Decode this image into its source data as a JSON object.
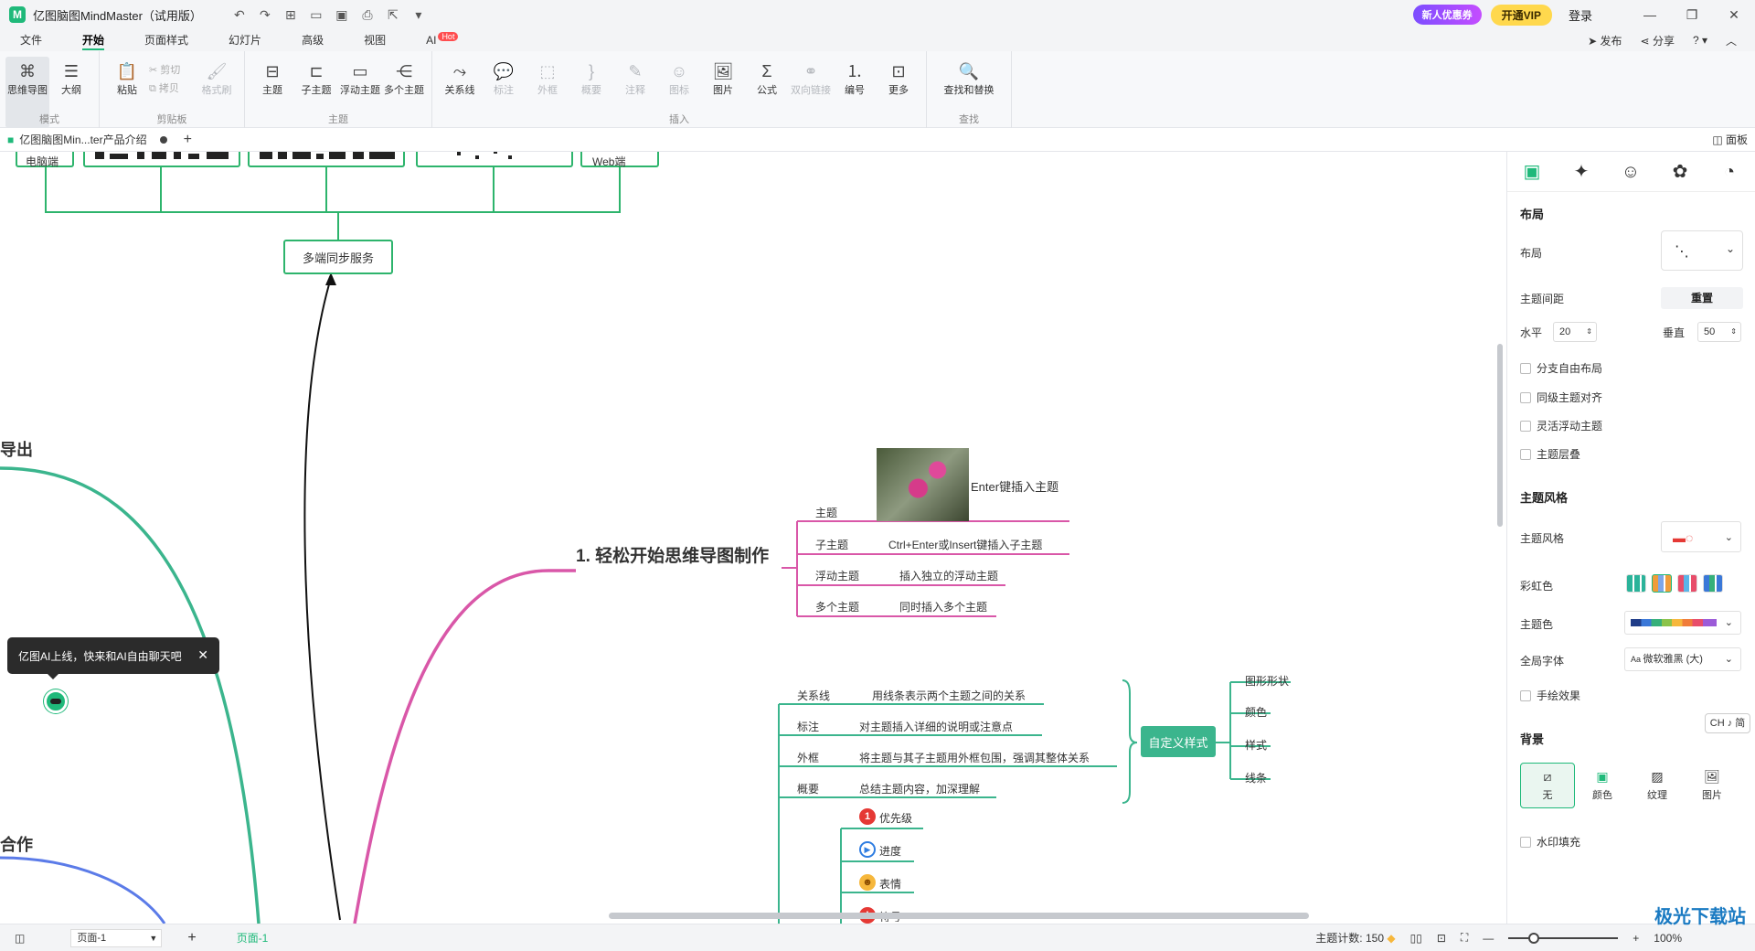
{
  "titlebar": {
    "app_title": "亿图脑图MindMaster（试用版）",
    "promo": "新人优惠券",
    "vip": "开通VIP",
    "login": "登录"
  },
  "menu": {
    "items": [
      "文件",
      "开始",
      "页面样式",
      "幻灯片",
      "高级",
      "视图",
      "AI"
    ],
    "hot": "Hot",
    "publish": "发布",
    "share": "分享"
  },
  "ribbon": {
    "mode": {
      "label": "模式",
      "mindmap": "思维导图",
      "outline": "大纲"
    },
    "clipboard": {
      "label": "剪贴板",
      "paste": "粘贴",
      "cut": "剪切",
      "copy": "拷贝",
      "format_painter": "格式刷"
    },
    "topic": {
      "label": "主题",
      "topic": "主题",
      "subtopic": "子主题",
      "floating": "浮动主题",
      "multi": "多个主题"
    },
    "insert": {
      "label": "插入",
      "relation": "关系线",
      "callout": "标注",
      "boundary": "外框",
      "summary": "概要",
      "note": "注释",
      "icon": "图标",
      "image": "图片",
      "formula": "公式",
      "hyperlink": "双向链接",
      "numbering": "编号",
      "more": "更多"
    },
    "find": {
      "label": "查找",
      "find_replace": "查找和替换"
    }
  },
  "tabs": {
    "doc_name": "亿图脑图Min...ter产品介绍",
    "panel_toggle": "面板"
  },
  "canvas": {
    "top_labels": {
      "pc": "电脑端",
      "web": "Web端"
    },
    "sync_service": "多端同步服务",
    "left_partial_1": "导出",
    "left_partial_2": "合作",
    "main_topic": "1. 轻松开始思维导图制作",
    "image_caption": "Enter键插入主题",
    "rows": [
      {
        "label": "主题",
        "desc": ""
      },
      {
        "label": "子主题",
        "desc": "Ctrl+Enter或Insert键插入子主题"
      },
      {
        "label": "浮动主题",
        "desc": "插入独立的浮动主题"
      },
      {
        "label": "多个主题",
        "desc": "同时插入多个主题"
      }
    ],
    "rows2": [
      {
        "label": "关系线",
        "desc": "用线条表示两个主题之间的关系"
      },
      {
        "label": "标注",
        "desc": "对主题插入详细的说明或注意点"
      },
      {
        "label": "外框",
        "desc": "将主题与其子主题用外框包围，强调其整体关系"
      },
      {
        "label": "概要",
        "desc": "总结主题内容，加深理解"
      }
    ],
    "custom_style": "自定义样式",
    "custom_items": [
      "图形形状",
      "颜色",
      "样式",
      "线条"
    ],
    "markers": [
      "优先级",
      "进度",
      "表情",
      "符号"
    ],
    "ai_toast": "亿图AI上线，快来和AI自由聊天吧"
  },
  "panel": {
    "layout_section": "布局",
    "layout_label": "布局",
    "spacing_label": "主题间距",
    "reset": "重置",
    "horizontal_label": "水平",
    "horizontal_value": "20",
    "vertical_label": "垂直",
    "vertical_value": "50",
    "checks1": [
      "分支自由布局",
      "同级主题对齐",
      "灵活浮动主题",
      "主题层叠"
    ],
    "style_section": "主题风格",
    "style_label": "主题风格",
    "rainbow_label": "彩虹色",
    "theme_color_label": "主题色",
    "font_label": "全局字体",
    "font_value": "微软雅黑 (大)",
    "hand_drawn": "手绘效果",
    "bg_section": "背景",
    "bg_options": [
      "无",
      "颜色",
      "纹理",
      "图片"
    ],
    "watermark_fill": "水印填充",
    "ime": "CH ♪ 简"
  },
  "status": {
    "page_select": "页面-1",
    "page_tab": "页面-1",
    "topic_count_label": "主题计数:",
    "topic_count": "150",
    "zoom": "100%"
  },
  "watermark": "极光下载站",
  "colors": {
    "accent": "#1fb97a",
    "pink": "#d957a8",
    "teal": "#3bb58d",
    "blue": "#5b7be8"
  }
}
